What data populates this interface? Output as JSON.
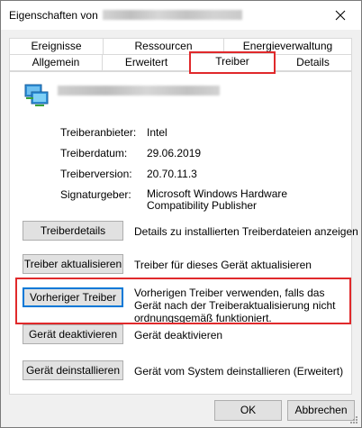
{
  "window": {
    "title": "Eigenschaften von"
  },
  "tabs": {
    "row1": [
      "Ereignisse",
      "Ressourcen",
      "Energieverwaltung"
    ],
    "row2": [
      "Allgemein",
      "Erweitert",
      "Treiber",
      "Details"
    ],
    "active": "Treiber"
  },
  "driver_info": {
    "provider_label": "Treiberanbieter:",
    "provider_value": "Intel",
    "date_label": "Treiberdatum:",
    "date_value": "29.06.2019",
    "version_label": "Treiberversion:",
    "version_value": "20.70.11.3",
    "signer_label": "Signaturgeber:",
    "signer_value": "Microsoft Windows Hardware Compatibility Publisher"
  },
  "actions": {
    "details_label": "Treiberdetails",
    "details_desc": "Details zu installierten Treiberdateien anzeigen",
    "update_label": "Treiber aktualisieren",
    "update_desc": "Treiber für dieses Gerät aktualisieren",
    "rollback_label": "Vorheriger Treiber",
    "rollback_desc": "Vorherigen Treiber verwenden, falls das Gerät nach der Treiberaktualisierung nicht ordnungsgemäß funktioniert.",
    "disable_label": "Gerät deaktivieren",
    "disable_desc": "Gerät deaktivieren",
    "uninstall_label": "Gerät deinstallieren",
    "uninstall_desc": "Gerät vom System deinstallieren (Erweitert)"
  },
  "footer": {
    "ok_label": "OK",
    "cancel_label": "Abbrechen"
  },
  "icons": {
    "close": "close-icon",
    "device": "network-adapter-icon"
  },
  "colors": {
    "highlight": "#e0292b",
    "focus": "#0078d7"
  }
}
